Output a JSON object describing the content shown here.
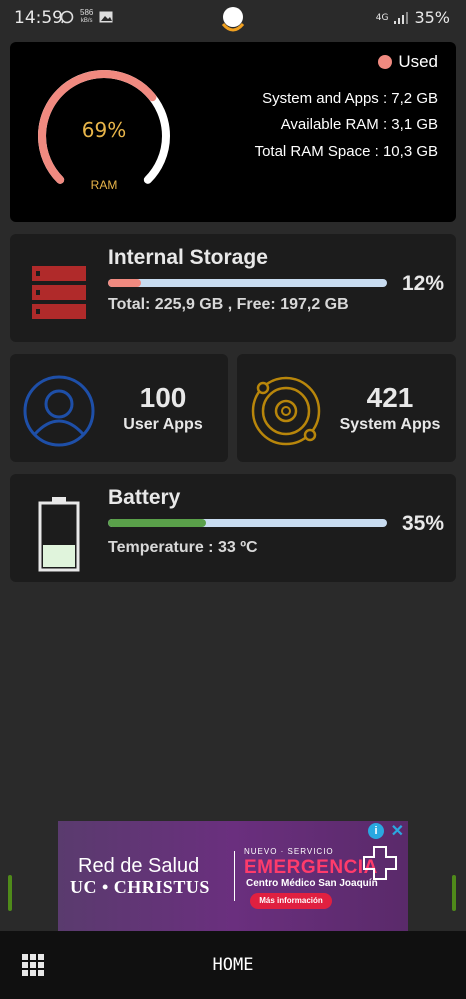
{
  "status_bar": {
    "time": "14:59",
    "net_speed_value": "586",
    "net_speed_unit": "kB/s",
    "network": "4G",
    "battery": "35%"
  },
  "ram": {
    "percent": "69%",
    "percent_value": 0.69,
    "label": "RAM",
    "legend": "Used",
    "system_and_apps": "System and Apps : 7,2 GB",
    "available": "Available RAM : 3,1 GB",
    "total": "Total RAM Space : 10,3 GB",
    "colors": {
      "used": "#f08a80",
      "free": "#ffffff",
      "text": "#e8b54a"
    }
  },
  "storage": {
    "title": "Internal Storage",
    "details": "Total:  225,9 GB ,  Free: 197,2 GB",
    "percent": "12%",
    "fill_fraction": 0.12,
    "fill_color": "#f08a80",
    "icon": "server-stack-icon"
  },
  "user_apps": {
    "count": "100",
    "label": "User Apps",
    "icon": "user-icon",
    "color": "#1e4fa8"
  },
  "system_apps": {
    "count": "421",
    "label": "System Apps",
    "icon": "orbit-gear-icon",
    "color": "#b8860b"
  },
  "battery": {
    "title": "Battery",
    "temperature": "Temperature : 33 ºC",
    "percent": "35%",
    "fill_fraction": 0.35,
    "fill_color": "#5aa04a",
    "icon": "battery-icon"
  },
  "ad": {
    "left_title": "Red de Salud",
    "left_sub": "UC • CHRISTUS",
    "tag": "NUEVO · SERVICIO",
    "headline": "EMERGENCIA",
    "center": "Centro Médico San Joaquín",
    "button": "Más información"
  },
  "bottom_bar": {
    "home_label": "HOME"
  }
}
